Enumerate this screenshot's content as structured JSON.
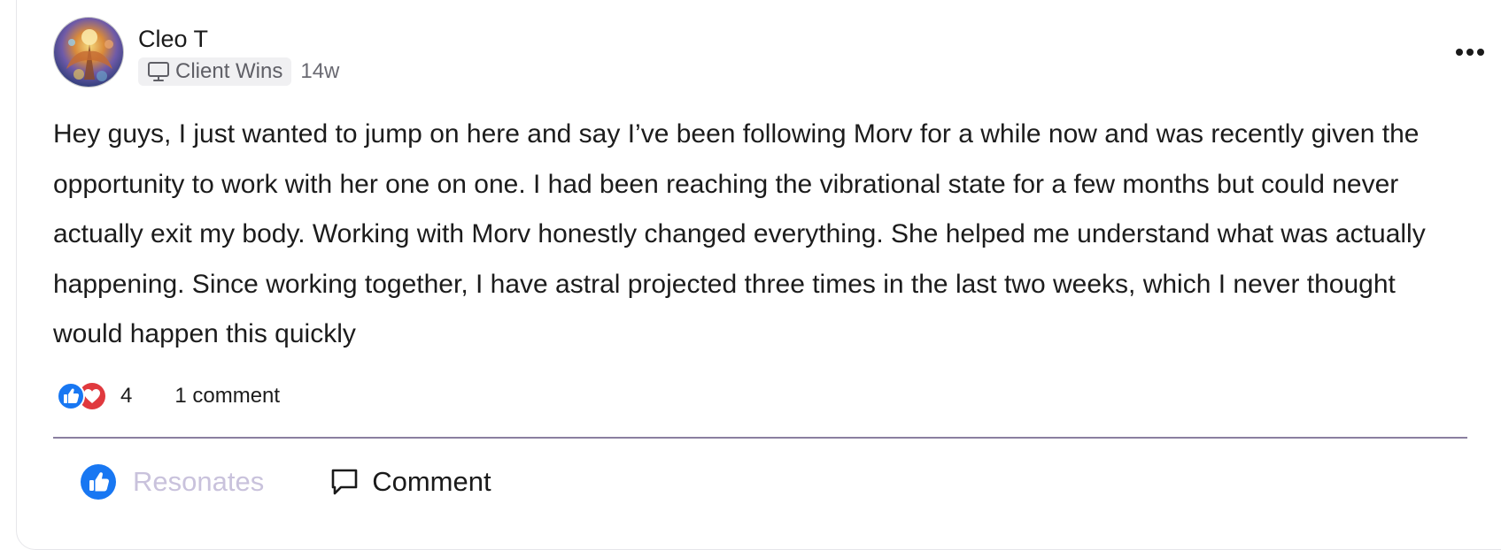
{
  "post": {
    "author": {
      "name": "Cleo T",
      "avatar_icon": "avatar-image"
    },
    "category": {
      "icon": "monitor-icon",
      "label": "Client Wins"
    },
    "age": "14w",
    "more_icon": "more-horizontal-icon",
    "body": "Hey guys, I just wanted to jump on here and say I’ve been following Morv for a while now and was recently given the opportunity to work with her one on one. I had been reaching the vibrational state for a few months but could never actually exit my body. Working with Morv honestly changed everything. She helped me understand what was actually happening. Since working together, I have astral projected three times in the last two weeks, which I never thought would happen this quickly",
    "stats": {
      "reaction_icons": [
        "thumbs-up-icon",
        "heart-icon"
      ],
      "reaction_count": "4",
      "comment_count": "1 comment"
    },
    "actions": {
      "resonates_label": "Resonates",
      "comment_label": "Comment"
    }
  },
  "colors": {
    "like_blue": "#1877f2",
    "love_red": "#e0393e",
    "resonates_text": "#c9c2dc",
    "divider": "#8a7fa0"
  }
}
